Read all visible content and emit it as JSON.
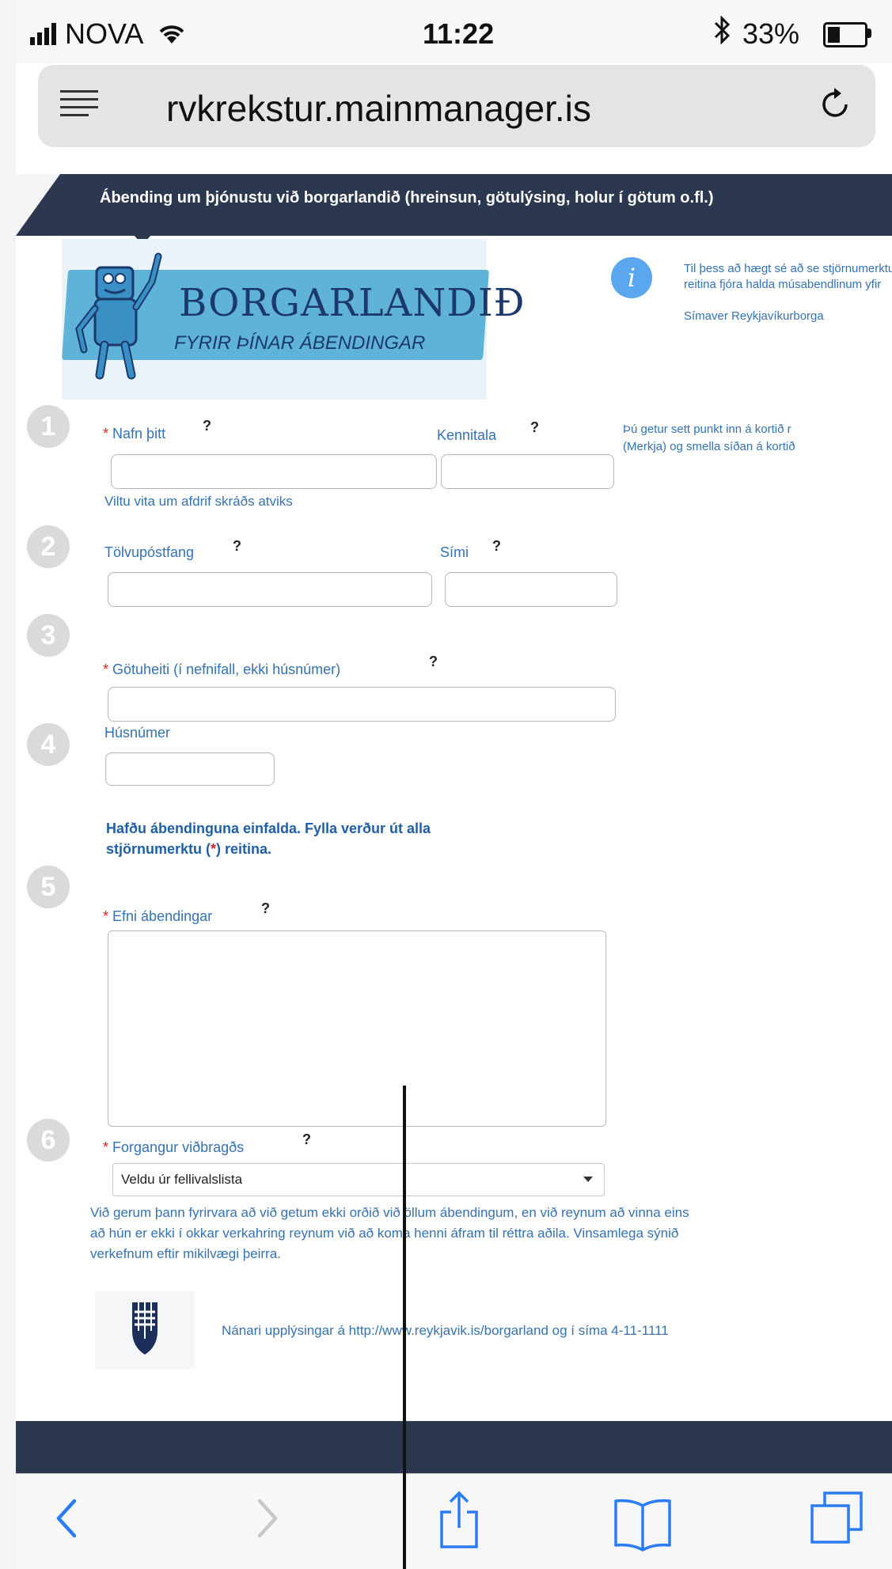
{
  "status_bar": {
    "carrier": "NOVA",
    "time": "11:22",
    "battery": "33%",
    "battery_level": 0.33
  },
  "browser": {
    "url": "rvkrekstur.mainmanager.is"
  },
  "breadcrumb": "Ábending um þjónustu við borgarlandið (hreinsun, götulýsing, holur í götum o.fl.)",
  "logo": {
    "title": "BORGARLANDIÐ",
    "subtitle": "FYRIR ÞÍNAR ÁBENDINGAR"
  },
  "info_panel": {
    "text": "Til þess að hægt sé að se stjörnumerktu reitina fjóra halda músabendlinum yfir",
    "footer": "Símaver Reykjavíkurborga"
  },
  "map_hint": {
    "line1": "Þú getur sett punkt inn á kortið r",
    "line2": "(Merkja) og smella síðan á kortið"
  },
  "steps": [
    "1",
    "2",
    "3",
    "4",
    "5",
    "6"
  ],
  "form": {
    "required_mark": "*",
    "help_mark": "?",
    "name_label": "Nafn þitt",
    "kennitala_label": "Kennitala",
    "track_link": "Viltu vita um afdrif skráðs atviks",
    "email_label": "Tölvupóstfang",
    "phone_label": "Sími",
    "street_label": "Götuheiti (í nefnifall, ekki húsnúmer)",
    "house_label": "Húsnúmer",
    "hint_line1": "Hafðu ábendinguna einfalda. Fylla verður út alla",
    "hint_line2_a": "stjörnumerktu (",
    "hint_line2_b": ") reitina.",
    "subject_label": "Efni ábendingar",
    "priority_label": "Forgangur viðbragðs",
    "priority_selected": "Veldu úr fellivalslista"
  },
  "disclaimer": {
    "line1": "Við gerum þann fyrirvara að við getum ekki orðið við öllum ábendingum, en við reynum að vinna eins",
    "line2": "að hún er ekki í okkar verkahring reynum við að koma henni áfram til réttra aðila. Vinsamlega sýnið",
    "line3": "verkefnum eftir mikilvægi þeirra."
  },
  "footer": {
    "text": "Nánari upplýsingar á http://www.reykjavik.is/borgarland og í síma 4-11-1111"
  },
  "toolbar": {
    "back": "‹",
    "forward": "›"
  }
}
